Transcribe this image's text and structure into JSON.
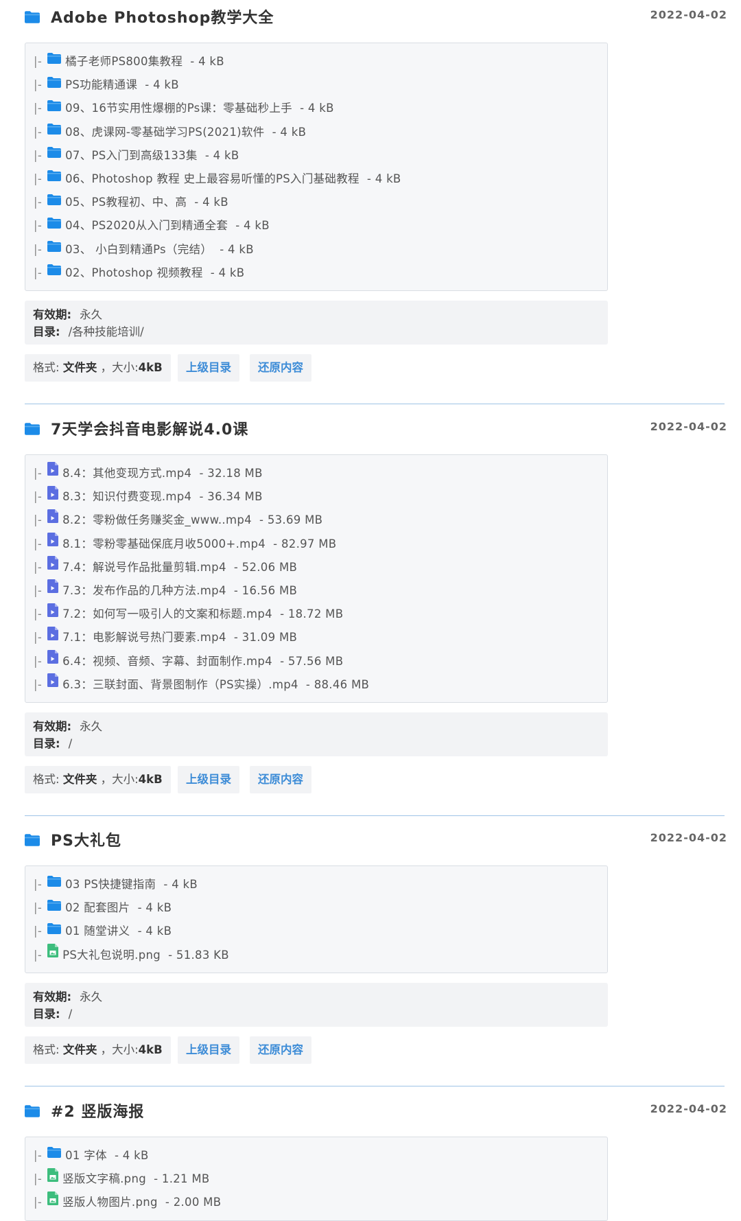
{
  "results": [
    {
      "title": "Adobe Photoshop教学大全",
      "date": "2022-04-02",
      "items": [
        {
          "icon": "folder-icon",
          "name": "橘子老师PS800集教程",
          "size": "4 kB"
        },
        {
          "icon": "folder-icon",
          "name": "PS功能精通课",
          "size": "4 kB"
        },
        {
          "icon": "folder-icon",
          "name": "09、16节实用性爆棚的Ps课：零基础秒上手",
          "size": "4 kB"
        },
        {
          "icon": "folder-icon",
          "name": "08、虎课网-零基础学习PS(2021)软件",
          "size": "4 kB"
        },
        {
          "icon": "folder-icon",
          "name": "07、PS入门到高级133集",
          "size": "4 kB"
        },
        {
          "icon": "folder-icon",
          "name": "06、Photoshop 教程 史上最容易听懂的PS入门基础教程",
          "size": "4 kB"
        },
        {
          "icon": "folder-icon",
          "name": "05、PS教程初、中、高",
          "size": "4 kB"
        },
        {
          "icon": "folder-icon",
          "name": "04、PS2020从入门到精通全套",
          "size": "4 kB"
        },
        {
          "icon": "folder-icon",
          "name": "03、 小白到精通Ps（完结）",
          "size": "4 kB"
        },
        {
          "icon": "folder-icon",
          "name": "02、Photoshop 视频教程",
          "size": "4 kB"
        }
      ],
      "validity_label": "有效期:",
      "validity": "永久",
      "dir_label": "目录:",
      "dir": "/各种技能培训/",
      "format_label": "格式:",
      "format": "文件夹",
      "size_label": "，大小:",
      "size": "4kB",
      "parent_btn": "上级目录",
      "restore_btn": "还原内容"
    },
    {
      "title": "7天学会抖音电影解说4.0课",
      "date": "2022-04-02",
      "items": [
        {
          "icon": "video-file-icon",
          "name": "8.4：其他变现方式.mp4",
          "size": "32.18 MB"
        },
        {
          "icon": "video-file-icon",
          "name": "8.3：知识付费变现.mp4",
          "size": "36.34 MB"
        },
        {
          "icon": "video-file-icon",
          "name": "8.2：零粉做任务赚奖金_www..mp4",
          "size": "53.69 MB"
        },
        {
          "icon": "video-file-icon",
          "name": "8.1：零粉零基础保底月收5000+.mp4",
          "size": "82.97 MB"
        },
        {
          "icon": "video-file-icon",
          "name": "7.4：解说号作品批量剪辑.mp4",
          "size": "52.06 MB"
        },
        {
          "icon": "video-file-icon",
          "name": "7.3：发布作品的几种方法.mp4",
          "size": "16.56 MB"
        },
        {
          "icon": "video-file-icon",
          "name": "7.2：如何写一吸引人的文案和标题.mp4",
          "size": "18.72 MB"
        },
        {
          "icon": "video-file-icon",
          "name": "7.1：电影解说号热门要素.mp4",
          "size": "31.09 MB"
        },
        {
          "icon": "video-file-icon",
          "name": "6.4：视频、音频、字幕、封面制作.mp4",
          "size": "57.56 MB"
        },
        {
          "icon": "video-file-icon",
          "name": "6.3：三联封面、背景图制作（PS实操）.mp4",
          "size": "88.46 MB"
        }
      ],
      "validity_label": "有效期:",
      "validity": "永久",
      "dir_label": "目录:",
      "dir": "/",
      "format_label": "格式:",
      "format": "文件夹",
      "size_label": "，大小:",
      "size": "4kB",
      "parent_btn": "上级目录",
      "restore_btn": "还原内容"
    },
    {
      "title": "PS大礼包",
      "date": "2022-04-02",
      "items": [
        {
          "icon": "folder-icon",
          "name": "03 PS快捷键指南",
          "size": "4 kB"
        },
        {
          "icon": "folder-icon",
          "name": "02 配套图片",
          "size": "4 kB"
        },
        {
          "icon": "folder-icon",
          "name": "01 随堂讲义",
          "size": "4 kB"
        },
        {
          "icon": "image-file-icon",
          "name": "PS大礼包说明.png",
          "size": "51.83 KB"
        }
      ],
      "validity_label": "有效期:",
      "validity": "永久",
      "dir_label": "目录:",
      "dir": "/",
      "format_label": "格式:",
      "format": "文件夹",
      "size_label": "，大小:",
      "size": "4kB",
      "parent_btn": "上级目录",
      "restore_btn": "还原内容"
    },
    {
      "title": "#2 竖版海报",
      "date": "2022-04-02",
      "items": [
        {
          "icon": "folder-icon",
          "name": "01 字体",
          "size": "4 kB"
        },
        {
          "icon": "image-file-icon",
          "name": "竖版文字稿.png",
          "size": "1.21 MB"
        },
        {
          "icon": "image-file-icon",
          "name": "竖版人物图片.png",
          "size": "2.00 MB"
        }
      ]
    }
  ],
  "item_prefix": "|-",
  "size_separator": "-",
  "colors": {
    "folder": "#1c8be8",
    "video_file": "#5b6ee1",
    "image_file": "#3dbd7d",
    "link": "#3d8cd7",
    "separator": "#9ec3e6"
  }
}
